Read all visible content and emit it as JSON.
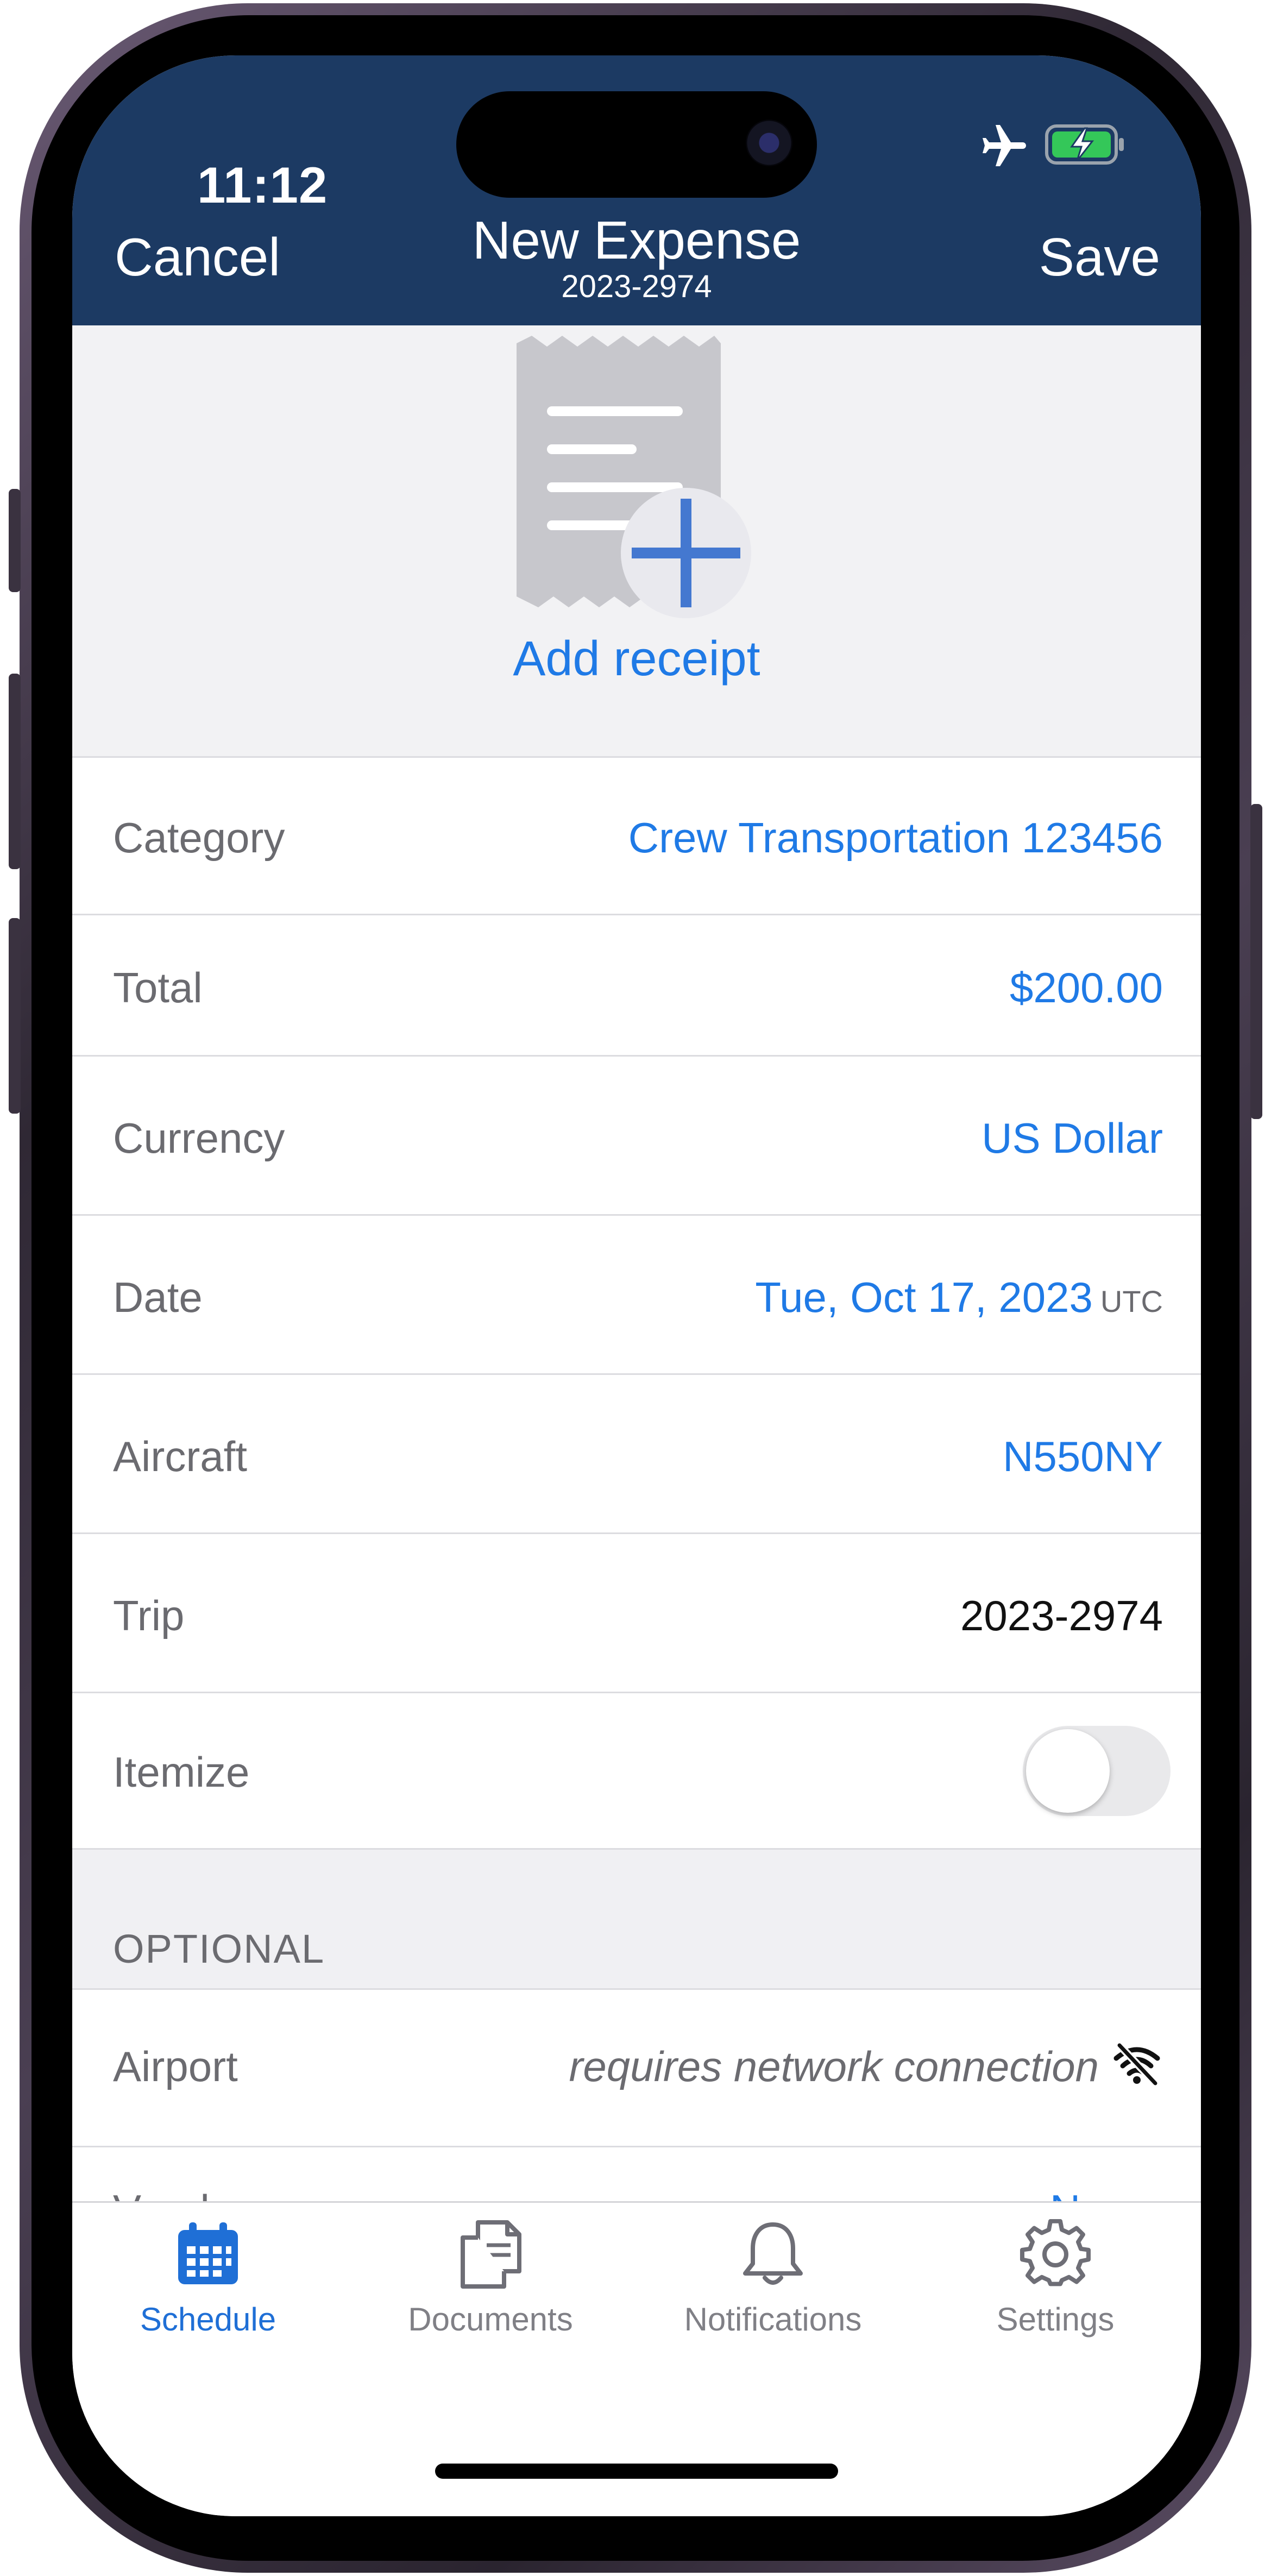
{
  "status": {
    "time": "11:12"
  },
  "nav": {
    "cancel": "Cancel",
    "title": "New Expense",
    "subtitle": "2023-2974",
    "save": "Save"
  },
  "receipt": {
    "add_label": "Add receipt"
  },
  "fields": {
    "category": {
      "label": "Category",
      "value": "Crew Transportation 123456"
    },
    "total": {
      "label": "Total",
      "value": "$200.00"
    },
    "currency": {
      "label": "Currency",
      "value": "US Dollar"
    },
    "date": {
      "label": "Date",
      "value": "Tue, Oct 17, 2023",
      "tz": "UTC"
    },
    "aircraft": {
      "label": "Aircraft",
      "value": "N550NY"
    },
    "trip": {
      "label": "Trip",
      "value": "2023-2974"
    },
    "itemize": {
      "label": "Itemize",
      "on": false
    }
  },
  "optional": {
    "header": "OPTIONAL",
    "airport": {
      "label": "Airport",
      "note": "requires network connection"
    },
    "vendor": {
      "label": "Vendor",
      "value": "Name"
    }
  },
  "tabs": [
    {
      "label": "Schedule",
      "icon": "calendar-icon",
      "active": true
    },
    {
      "label": "Documents",
      "icon": "documents-icon",
      "active": false
    },
    {
      "label": "Notifications",
      "icon": "bell-icon",
      "active": false
    },
    {
      "label": "Settings",
      "icon": "gear-icon",
      "active": false
    }
  ],
  "colors": {
    "nav_bg": "#1c3a63",
    "accent": "#1f7ae6",
    "label_gray": "#6b6b70",
    "section_bg": "#f0f0f3"
  }
}
